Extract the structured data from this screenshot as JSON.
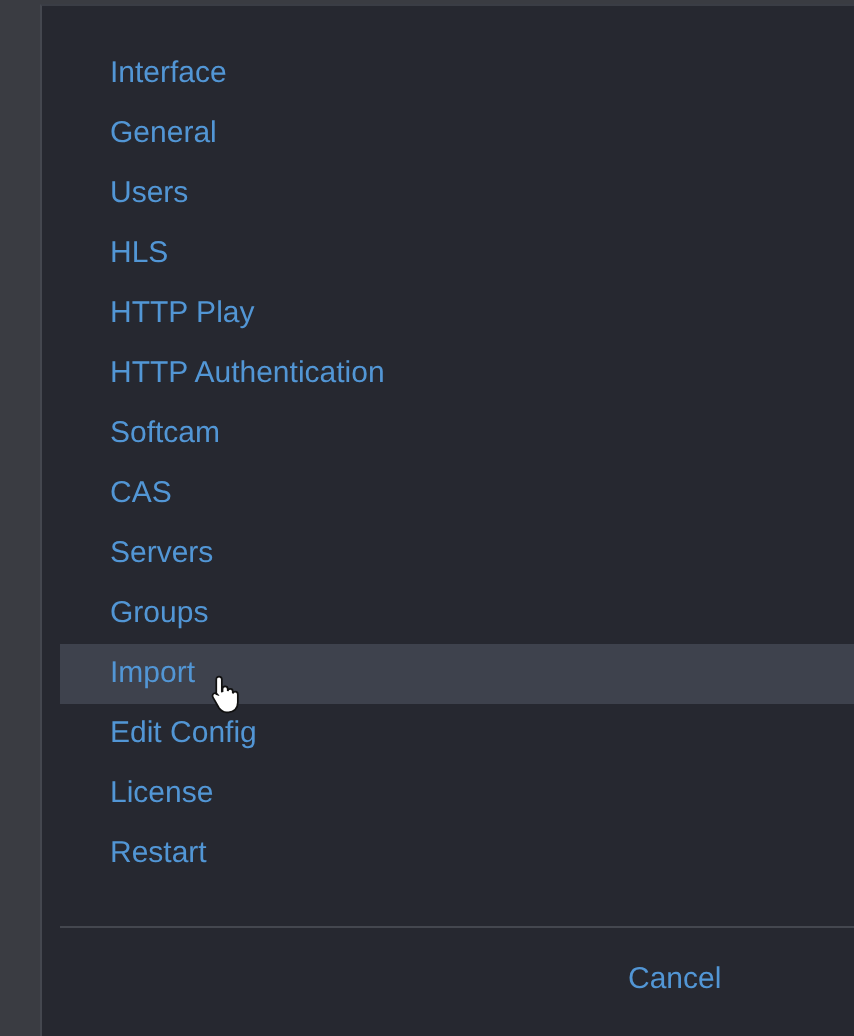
{
  "menu": {
    "items": [
      {
        "label": "Interface",
        "selected": false
      },
      {
        "label": "General",
        "selected": false
      },
      {
        "label": "Users",
        "selected": false
      },
      {
        "label": "HLS",
        "selected": false
      },
      {
        "label": "HTTP Play",
        "selected": false
      },
      {
        "label": "HTTP Authentication",
        "selected": false
      },
      {
        "label": "Softcam",
        "selected": false
      },
      {
        "label": "CAS",
        "selected": false
      },
      {
        "label": "Servers",
        "selected": false
      },
      {
        "label": "Groups",
        "selected": false
      },
      {
        "label": "Import",
        "selected": true
      },
      {
        "label": "Edit Config",
        "selected": false
      },
      {
        "label": "License",
        "selected": false
      },
      {
        "label": "Restart",
        "selected": false
      }
    ]
  },
  "buttons": [
    "Cancel"
  ]
}
